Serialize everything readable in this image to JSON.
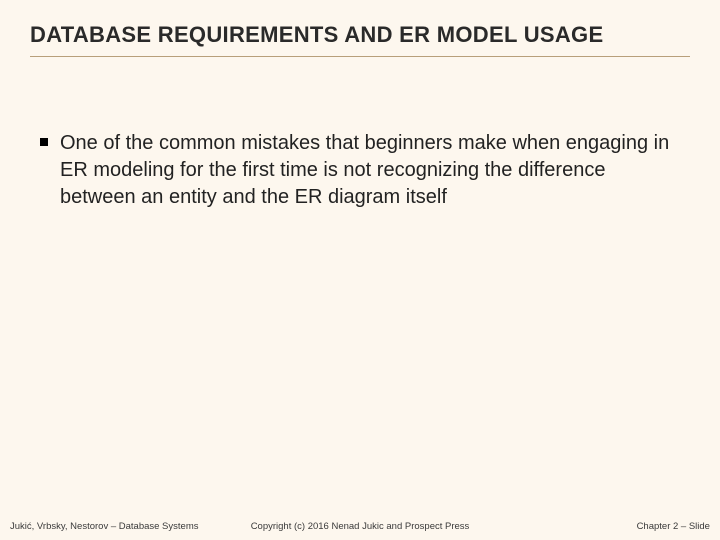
{
  "title": "DATABASE REQUIREMENTS AND ER MODEL USAGE",
  "bullets": [
    "One of the common mistakes that beginners make when engaging in ER modeling for the first time is not recognizing the difference between an entity and the ER diagram itself"
  ],
  "footer": {
    "left": "Jukić, Vrbsky, Nestorov – Database Systems",
    "center": "Copyright (c) 2016 Nenad Jukic and Prospect Press",
    "right": "Chapter 2 – Slide"
  }
}
